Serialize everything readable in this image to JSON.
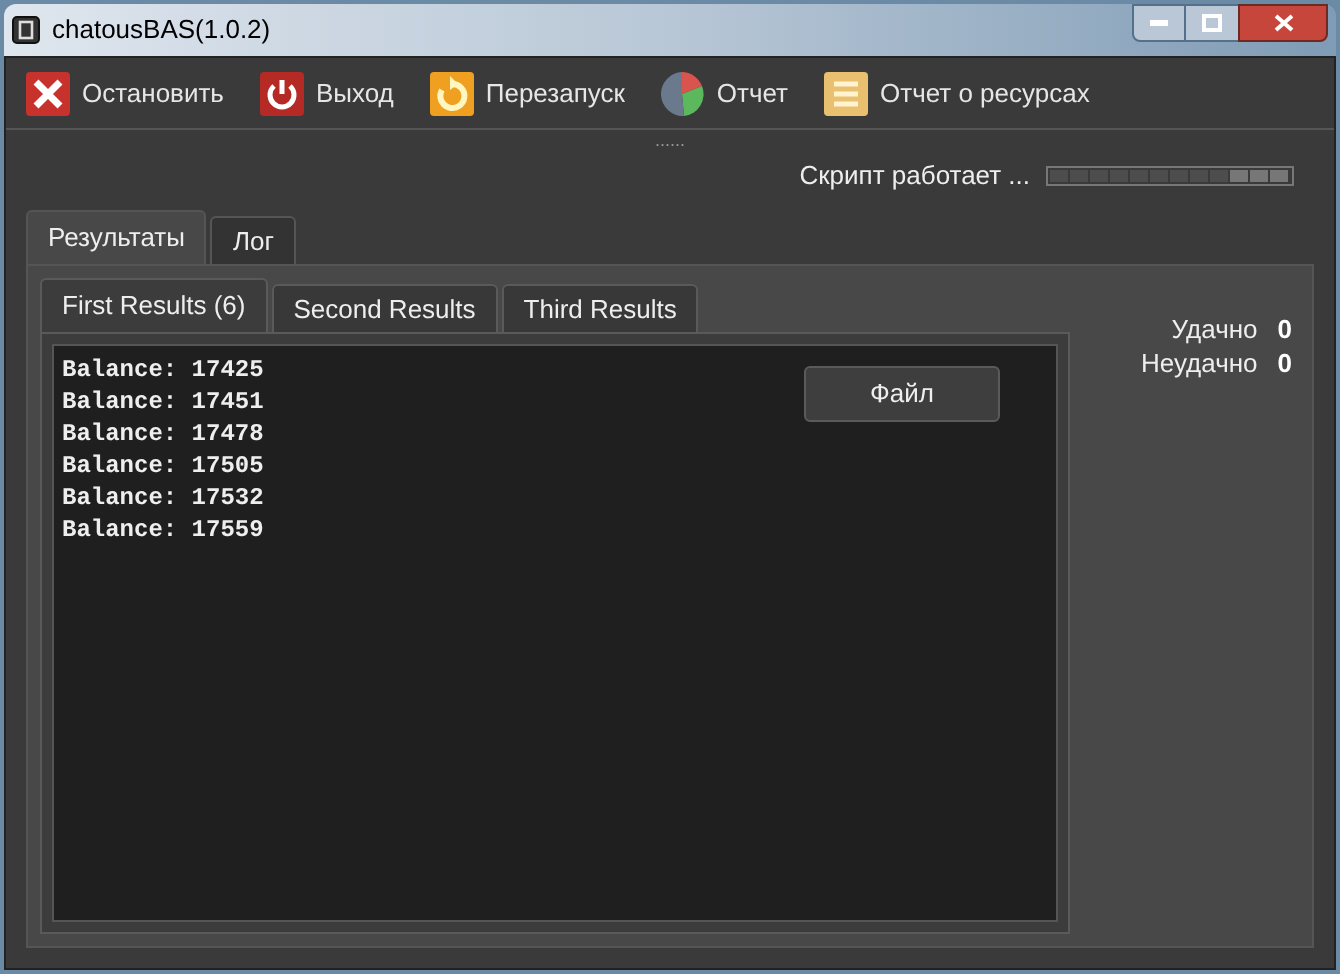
{
  "window": {
    "title": "chatousBAS(1.0.2)"
  },
  "toolbar": [
    {
      "kind": "stop",
      "label": "Остановить"
    },
    {
      "kind": "exit",
      "label": "Выход"
    },
    {
      "kind": "restart",
      "label": "Перезапуск"
    },
    {
      "kind": "report",
      "label": "Отчет"
    },
    {
      "kind": "resources",
      "label": "Отчет о ресурсах"
    }
  ],
  "splitter": "......",
  "status": {
    "text": "Скрипт работает ..."
  },
  "tabs": [
    {
      "label": "Результаты",
      "selected": true
    },
    {
      "label": "Лог",
      "selected": false
    }
  ],
  "result_tabs": [
    {
      "label": "First Results (6)",
      "selected": true
    },
    {
      "label": "Second Results",
      "selected": false
    },
    {
      "label": "Third Results",
      "selected": false
    }
  ],
  "results": [
    "Balance: 17425",
    "Balance: 17451",
    "Balance: 17478",
    "Balance: 17505",
    "Balance: 17532",
    "Balance: 17559"
  ],
  "file_button": "Файл",
  "stats": [
    {
      "label": "Удачно",
      "value": "0"
    },
    {
      "label": "Неудачно",
      "value": "0"
    }
  ]
}
